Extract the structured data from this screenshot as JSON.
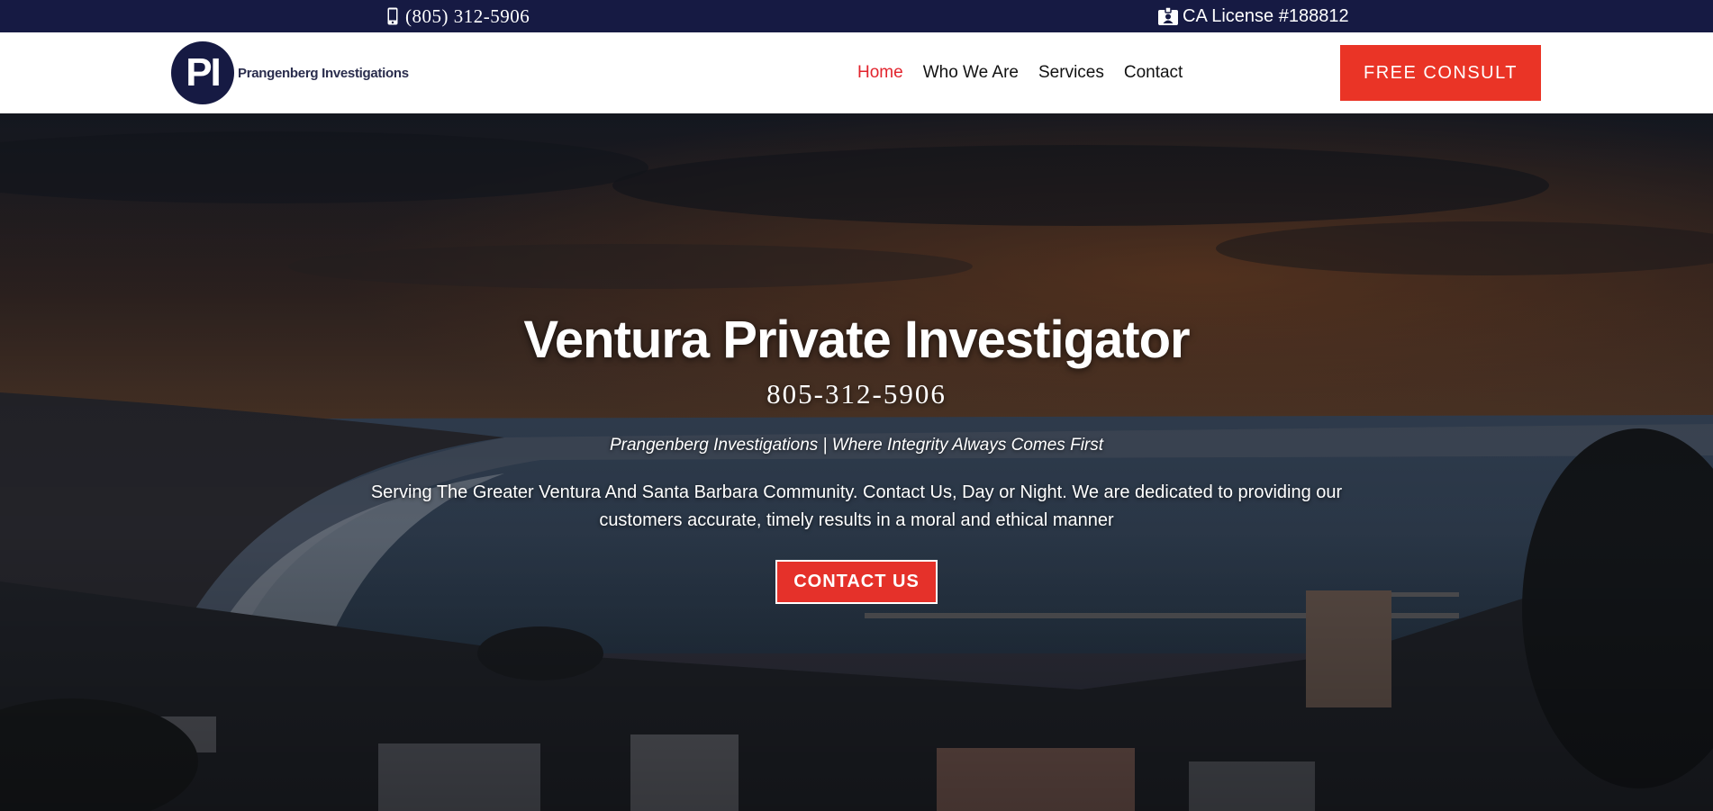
{
  "topbar": {
    "phone": "(805) 312-5906",
    "phone_icon": "mobile-phone-icon",
    "license": "CA License #188812",
    "license_icon": "id-badge-icon",
    "background": "#161a43"
  },
  "header": {
    "logo": {
      "monogram": "PI",
      "name": "Prangenberg Investigations"
    },
    "nav": [
      {
        "label": "Home",
        "active": true
      },
      {
        "label": "Who We Are",
        "active": false
      },
      {
        "label": "Services",
        "active": false
      },
      {
        "label": "Contact",
        "active": false
      }
    ],
    "cta_label": "FREE CONSULT"
  },
  "hero": {
    "title": "Ventura Private Investigator",
    "phone": "805-312-5906",
    "tagline": "Prangenberg Investigations | Where Integrity Always Comes First",
    "description": "Serving The Greater Ventura And Santa Barbara Community. Contact Us, Day or Night. We are dedicated to providing our customers accurate, timely results in a moral and ethical manner",
    "button_label": "CONTACT US",
    "background_image": "ventura-coastline-dusk-photo"
  },
  "colors": {
    "accent": "#e2242d",
    "navy": "#161a43",
    "button": "#ea3426"
  }
}
